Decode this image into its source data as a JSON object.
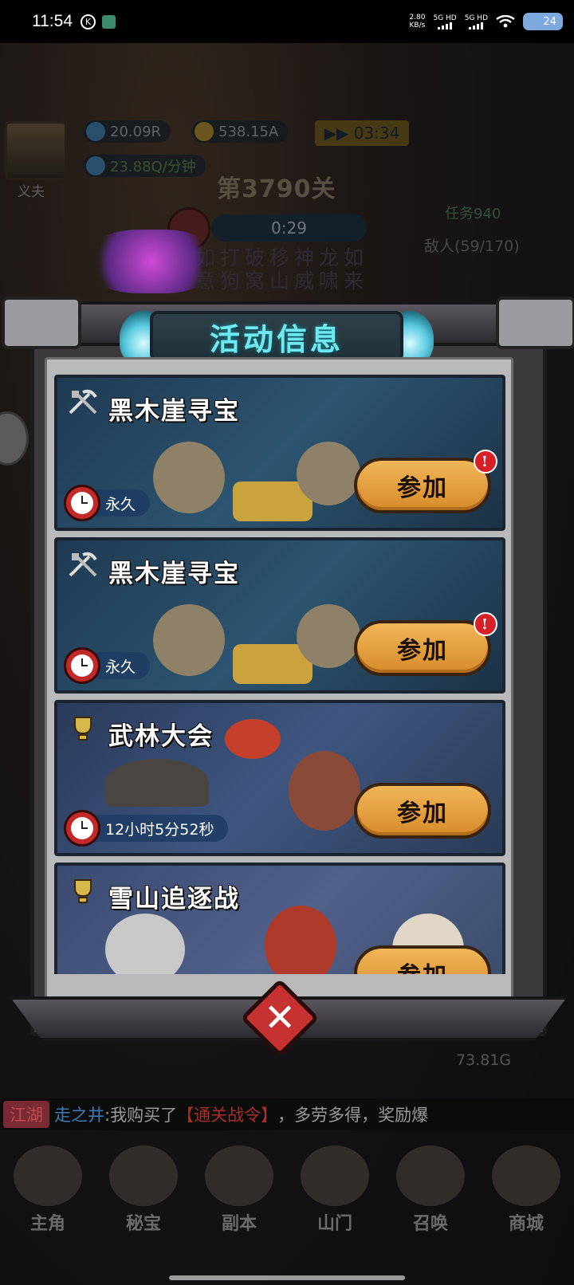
{
  "status_bar": {
    "time": "11:54",
    "k_badge": "K",
    "net_speed_value": "2.80",
    "net_speed_unit": "KB/s",
    "sim1": "5G HD",
    "sim2": "5G HD",
    "battery": "24"
  },
  "hud": {
    "player_name": "义夫",
    "gems": "20.09R",
    "gold": "538.15A",
    "speed": "03:34",
    "income": "23.88Q/分钟",
    "stage": "第3790关",
    "timer": "0:29",
    "task": "任务940",
    "enemies": "敌人(59/170)",
    "scroll_line1": "如打破移神龙如",
    "scroll_line2": "意狗窝山威啸来",
    "bottom_value": "73.81G"
  },
  "chat": {
    "channel": "江湖",
    "sender": "走之井",
    "message_prefix": ":我购买了",
    "highlight": "【通关战令】",
    "message_suffix": "，多劳多得，奖励爆"
  },
  "panel": {
    "title": "活动信息",
    "events": [
      {
        "name": "黑木崖寻宝",
        "time": "永久",
        "button": "参加",
        "has_alert": true,
        "icon": "pickaxe-shovel-icon"
      },
      {
        "name": "黑木崖寻宝",
        "time": "永久",
        "button": "参加",
        "has_alert": true,
        "icon": "pickaxe-shovel-icon"
      },
      {
        "name": "武林大会",
        "time": "12小时5分52秒",
        "button": "参加",
        "has_alert": false,
        "icon": "trophy-icon"
      },
      {
        "name": "雪山追逐战",
        "time": "",
        "button": "参加",
        "has_alert": false,
        "icon": "trophy-icon"
      }
    ],
    "alert_mark": "!",
    "close_label": "✕"
  },
  "bottom_nav": [
    {
      "label": "主角"
    },
    {
      "label": "秘宝"
    },
    {
      "label": "副本"
    },
    {
      "label": "山门"
    },
    {
      "label": "召唤"
    },
    {
      "label": "商城"
    }
  ],
  "colors": {
    "button_orange": "#e9a348",
    "title_cyan": "#6fe8f0",
    "alert_red": "#d61f27",
    "close_red": "#c63232"
  }
}
